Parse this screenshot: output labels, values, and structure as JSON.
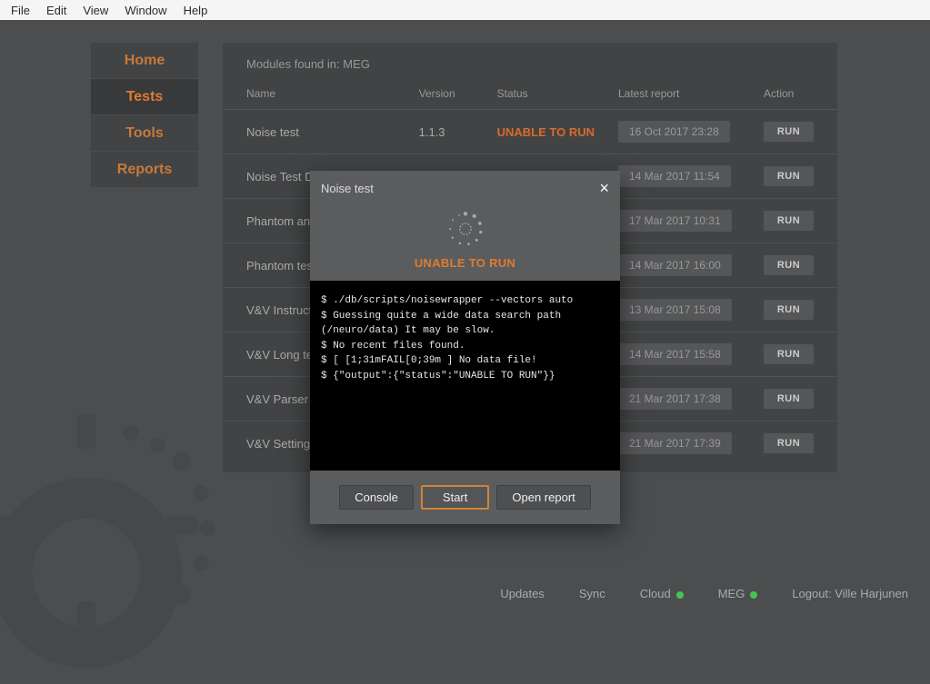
{
  "menubar": [
    "File",
    "Edit",
    "View",
    "Window",
    "Help"
  ],
  "sidebar": {
    "items": [
      {
        "label": "Home"
      },
      {
        "label": "Tests"
      },
      {
        "label": "Tools"
      },
      {
        "label": "Reports"
      }
    ],
    "active_index": 1
  },
  "content_header": "Modules found in: MEG",
  "table": {
    "columns": [
      "Name",
      "Version",
      "Status",
      "Latest report",
      "Action"
    ],
    "rows": [
      {
        "name": "Noise test",
        "version": "1.1.3",
        "status": "UNABLE TO RUN",
        "status_bad": true,
        "date": "16 Oct 2017 23:28"
      },
      {
        "name": "Noise Test DUMMY",
        "version": "",
        "status": "",
        "status_bad": false,
        "date": "14 Mar 2017 11:54"
      },
      {
        "name": "Phantom analysis",
        "version": "",
        "status": "",
        "status_bad": false,
        "date": "17 Mar 2017 10:31"
      },
      {
        "name": "Phantom test",
        "version": "",
        "status": "",
        "status_bad": false,
        "date": "14 Mar 2017 16:00"
      },
      {
        "name": "V&V Instructions",
        "version": "",
        "status": "",
        "status_bad": false,
        "date": "13 Mar 2017 15:08"
      },
      {
        "name": "V&V Long test",
        "version": "",
        "status": "",
        "status_bad": false,
        "date": "14 Mar 2017 15:58"
      },
      {
        "name": "V&V Parser unit tests",
        "version": "",
        "status": "",
        "status_bad": false,
        "date": "21 Mar 2017 17:38"
      },
      {
        "name": "V&V Settings test",
        "version": "",
        "status": "",
        "status_bad": false,
        "date": "21 Mar 2017 17:39"
      }
    ],
    "run_label": "RUN"
  },
  "modal": {
    "title": "Noise test",
    "status": "UNABLE TO RUN",
    "console_lines": [
      "$ ./db/scripts/noisewrapper --vectors auto",
      "$ Guessing quite a wide data search path (/neuro/data) It may be slow.",
      "$ No recent files found.",
      "$ [ [1;31mFAIL[0;39m ] No data file!",
      "$ {\"output\":{\"status\":\"UNABLE TO RUN\"}}"
    ],
    "buttons": {
      "console": "Console",
      "start": "Start",
      "open_report": "Open report"
    }
  },
  "footer": {
    "updates": "Updates",
    "sync": "Sync",
    "cloud": "Cloud",
    "meg": "MEG",
    "logout": "Logout: Ville Harjunen"
  }
}
